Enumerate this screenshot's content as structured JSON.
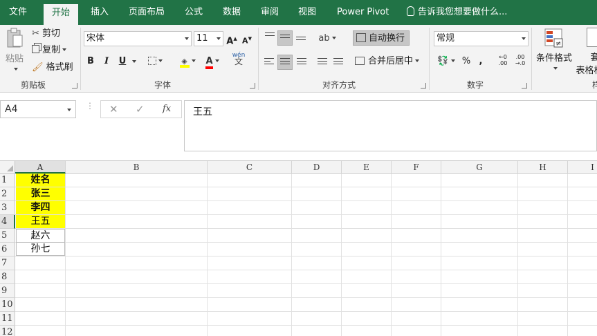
{
  "tabs": [
    "文件",
    "开始",
    "插入",
    "页面布局",
    "公式",
    "数据",
    "审阅",
    "视图",
    "Power Pivot"
  ],
  "active_tab": "开始",
  "tell_me": "告诉我您想要做什么...",
  "clipboard": {
    "paste": "粘贴",
    "cut": "剪切",
    "copy": "复制",
    "format_painter": "格式刷",
    "label": "剪贴板"
  },
  "font": {
    "name": "宋体",
    "size": "11",
    "bold": "B",
    "italic": "I",
    "underline": "U",
    "label": "字体",
    "phonetic": "wén"
  },
  "alignment": {
    "wrap_text": "自动换行",
    "merge_center": "合并后居中",
    "label": "对齐方式"
  },
  "number": {
    "format": "常规",
    "percent": "%",
    "comma": ",",
    "label": "数字"
  },
  "styles": {
    "conditional": "条件格式",
    "table_top": "套",
    "table_bottom": "表格格",
    "label_partial": "样"
  },
  "formula_bar": {
    "name_box": "A4",
    "content": "王五",
    "fx": "fx"
  },
  "columns": [
    "A",
    "B",
    "C",
    "D",
    "E",
    "F",
    "G",
    "H",
    "I"
  ],
  "rows": [
    "1",
    "2",
    "3",
    "4",
    "5",
    "6",
    "7",
    "8",
    "9",
    "10",
    "11",
    "12"
  ],
  "cells": [
    {
      "ref": "A1",
      "value": "姓名",
      "fill": "#ffff00",
      "bold": true
    },
    {
      "ref": "A2",
      "value": "张三",
      "fill": "#ffff00",
      "bold": true
    },
    {
      "ref": "A3",
      "value": "李四",
      "fill": "#ffff00",
      "bold": true
    },
    {
      "ref": "A4",
      "value": "王五",
      "fill": "#ffff00",
      "bold": false
    },
    {
      "ref": "A5",
      "value": "赵六",
      "fill": "",
      "bold": false
    },
    {
      "ref": "A6",
      "value": "孙七",
      "fill": "",
      "bold": false
    }
  ],
  "colors": {
    "ribbon_green": "#217346",
    "highlight_yellow": "#ffff00",
    "font_red": "#ff0000"
  }
}
